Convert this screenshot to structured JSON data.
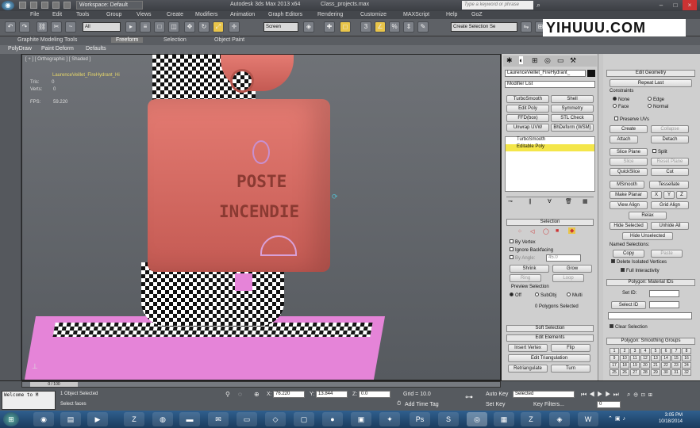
{
  "titlebar": {
    "workspace": "Workspace: Default",
    "app_title": "Autodesk 3ds Max 2013 x64",
    "file": "Class_projects.max",
    "search_placeholder": "Type a keyword or phrase"
  },
  "menu": [
    "File",
    "Edit",
    "Tools",
    "Group",
    "Views",
    "Create",
    "Modifiers",
    "Animation",
    "Graph Editors",
    "Rendering",
    "Customize",
    "MAXScript",
    "Help",
    "GoZ"
  ],
  "toolbar": {
    "filter": "All",
    "refcoord": "Screen",
    "selset": "Create Selection Se"
  },
  "watermark": "YIHUUU.COM",
  "ribbon": {
    "tabs": [
      "Graphite Modeling Tools",
      "Freeform",
      "Selection",
      "Object Paint"
    ],
    "subtabs": [
      "PolyDraw",
      "Paint Deform",
      "Defaults"
    ]
  },
  "viewport": {
    "label": "[ + ] [ Orthographic ] [ Shaded ]",
    "object": "LaurenceVeillet_FireHydrant_Hi",
    "tris_label": "Tris:",
    "tris": "0",
    "verts_label": "Verts:",
    "verts": "0",
    "fps_label": "FPS:",
    "fps": "59.220",
    "text1": "POSTE",
    "text2": "INCENDIE"
  },
  "command_panel": {
    "object_name": "LaurenceVeillet_FireHydrant_",
    "modifier_list": "Modifier List",
    "mod_buttons": [
      [
        "TurboSmooth",
        "Shell"
      ],
      [
        "Edit Poly",
        "Symmetry"
      ],
      [
        "FFD(box)",
        "STL Check"
      ],
      [
        "Unwrap UVW",
        "BhDeform (WSM)"
      ]
    ],
    "stack": [
      "TurboSmooth",
      "Editable Poly"
    ],
    "selection": {
      "title": "Selection",
      "by_vertex": "By Vertex",
      "ignore_backfacing": "Ignore Backfacing",
      "by_angle": "By Angle:",
      "angle": "45.0",
      "shrink": "Shrink",
      "grow": "Grow",
      "ring": "Ring",
      "loop": "Loop",
      "preview": "Preview Selection",
      "off": "Off",
      "subobj": "SubObj",
      "multi": "Multi",
      "status": "0 Polygons Selected"
    },
    "soft_selection": "Soft Selection",
    "edit_elements": {
      "title": "Edit Elements",
      "insert_vertex": "Insert Vertex",
      "flip": "Flip",
      "edit_triangulation": "Edit Triangulation",
      "retriangulate": "Retriangulate",
      "turn": "Turn"
    },
    "edit_geometry": {
      "title": "Edit Geometry",
      "repeat_last": "Repeat Last",
      "constraints": "Constraints",
      "none": "None",
      "edge": "Edge",
      "face": "Face",
      "normal": "Normal",
      "preserve_uvs": "Preserve UVs",
      "create": "Create",
      "collapse": "Collapse",
      "attach": "Attach",
      "detach": "Detach",
      "slice_plane": "Slice Plane",
      "split": "Split",
      "slice": "Slice",
      "reset_plane": "Reset Plane",
      "quickslice": "QuickSlice",
      "cut": "Cut",
      "msmooth": "MSmooth",
      "tessellate": "Tessellate",
      "make_planar": "Make Planar",
      "x": "X",
      "y": "Y",
      "z": "Z",
      "view_align": "View Align",
      "grid_align": "Grid Align",
      "relax": "Relax",
      "hide_selected": "Hide Selected",
      "unhide_all": "Unhide All",
      "hide_unselected": "Hide Unselected",
      "named_selections": "Named Selections:",
      "copy": "Copy",
      "paste": "Paste",
      "delete_isolated": "Delete Isolated Vertices",
      "full_interactivity": "Full Interactivity"
    },
    "material_ids": {
      "title": "Polygon: Material IDs",
      "set_id": "Set ID:",
      "select_id": "Select ID",
      "clear_selection": "Clear Selection"
    },
    "smoothing": {
      "title": "Polygon: Smoothing Groups",
      "groups": [
        "1",
        "2",
        "3",
        "4",
        "5",
        "6",
        "7",
        "8",
        "9",
        "10",
        "11",
        "12",
        "13",
        "14",
        "15",
        "16",
        "17",
        "18",
        "19",
        "20",
        "21",
        "22",
        "23",
        "24",
        "25",
        "26",
        "27",
        "28",
        "29",
        "30",
        "31",
        "32"
      ]
    }
  },
  "statusbar": {
    "slider": "0 / 100",
    "objects": "1 Object Selected",
    "prompt": "Select faces",
    "x_label": "X:",
    "x": "76.220",
    "y_label": "Y:",
    "y": "13.844",
    "z_label": "Z:",
    "z": "0.0",
    "grid": "Grid = 10.0",
    "add_time_tag": "Add Time Tag",
    "auto_key": "Auto Key",
    "set_key": "Set Key",
    "selected": "Selected",
    "key_filters": "Key Filters...",
    "frame": "0",
    "maxscript": "Welcome to M"
  },
  "taskbar": {
    "time": "3:05 PM",
    "date": "10/18/2014"
  }
}
